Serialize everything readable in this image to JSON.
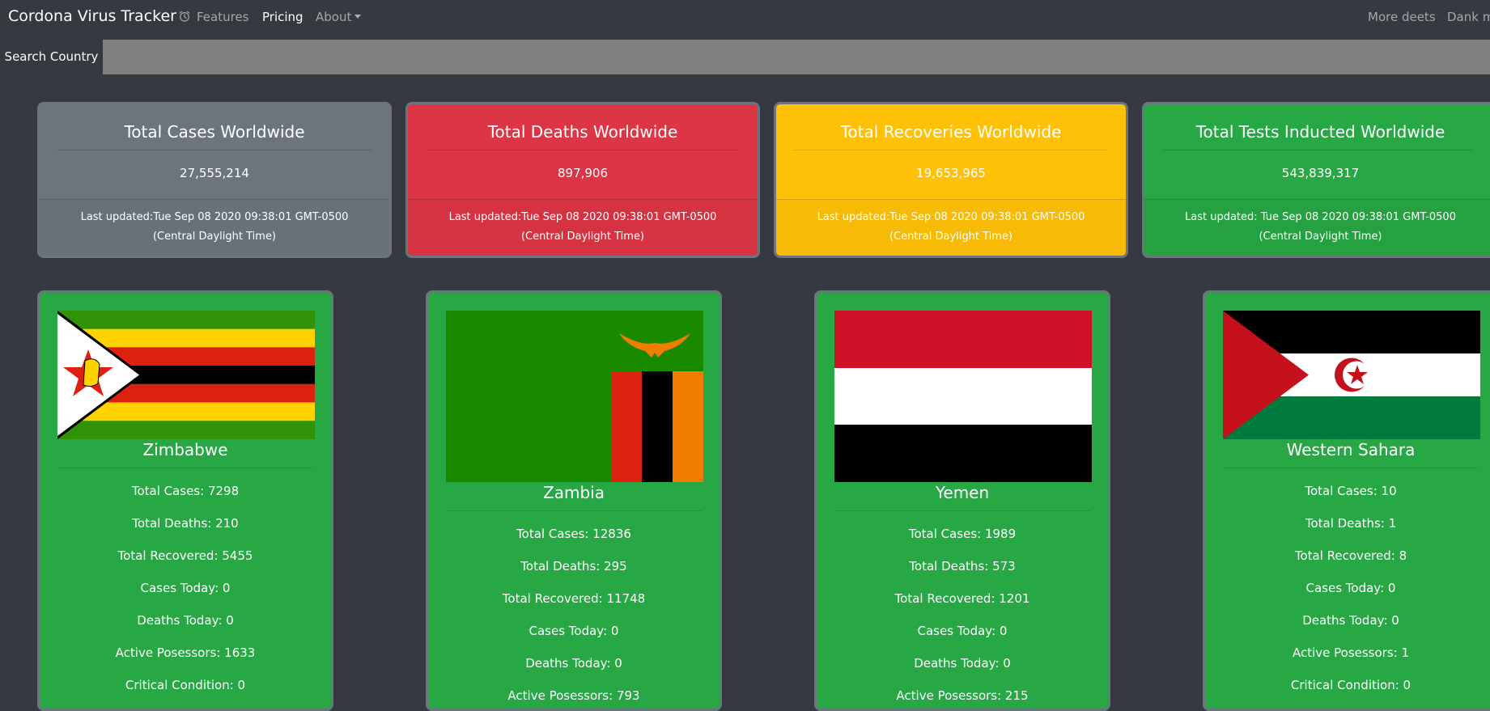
{
  "navbar": {
    "brand": "Cordona Virus Tracker",
    "items": [
      "Features",
      "Pricing",
      "About"
    ],
    "right_items": [
      "More deets",
      "Dank m"
    ]
  },
  "search": {
    "label": "Search Country",
    "placeholder": ""
  },
  "summary": [
    {
      "title": "Total Cases Worldwide",
      "value": "27,555,214",
      "updated": "Last updated:Tue Sep 08 2020 09:38:01 GMT-0500 (Central Daylight Time)",
      "color": "#6c757d"
    },
    {
      "title": "Total Deaths Worldwide",
      "value": "897,906",
      "updated": "Last updated:Tue Sep 08 2020 09:38:01 GMT-0500 (Central Daylight Time)",
      "color": "#dc3545"
    },
    {
      "title": "Total Recoveries Worldwide",
      "value": "19,653,965",
      "updated": "Last updated:Tue Sep 08 2020 09:38:01 GMT-0500 (Central Daylight Time)",
      "color": "#ffc107"
    },
    {
      "title": "Total Tests Inducted Worldwide",
      "value": "543,839,317",
      "updated": "Last updated: Tue Sep 08 2020 09:38:01 GMT-0500 (Central Daylight Time)",
      "color": "#28a745"
    }
  ],
  "countries": [
    {
      "name": "Zimbabwe",
      "flag_icon": "zimbabwe-flag",
      "stats": [
        "Total Cases: 7298",
        "Total Deaths: 210",
        "Total Recovered: 5455",
        "Cases Today: 0",
        "Deaths Today: 0",
        "Active Posessors: 1633",
        "Critical Condition: 0"
      ]
    },
    {
      "name": "Zambia",
      "flag_icon": "zambia-flag",
      "stats": [
        "Total Cases: 12836",
        "Total Deaths: 295",
        "Total Recovered: 11748",
        "Cases Today: 0",
        "Deaths Today: 0",
        "Active Posessors: 793"
      ]
    },
    {
      "name": "Yemen",
      "flag_icon": "yemen-flag",
      "stats": [
        "Total Cases: 1989",
        "Total Deaths: 573",
        "Total Recovered: 1201",
        "Cases Today: 0",
        "Deaths Today: 0",
        "Active Posessors: 215"
      ]
    },
    {
      "name": "Western Sahara",
      "flag_icon": "western-sahara-flag",
      "stats": [
        "Total Cases: 10",
        "Total Deaths: 1",
        "Total Recovered: 8",
        "Cases Today: 0",
        "Deaths Today: 0",
        "Active Posessors: 1",
        "Critical Condition: 0"
      ]
    }
  ]
}
